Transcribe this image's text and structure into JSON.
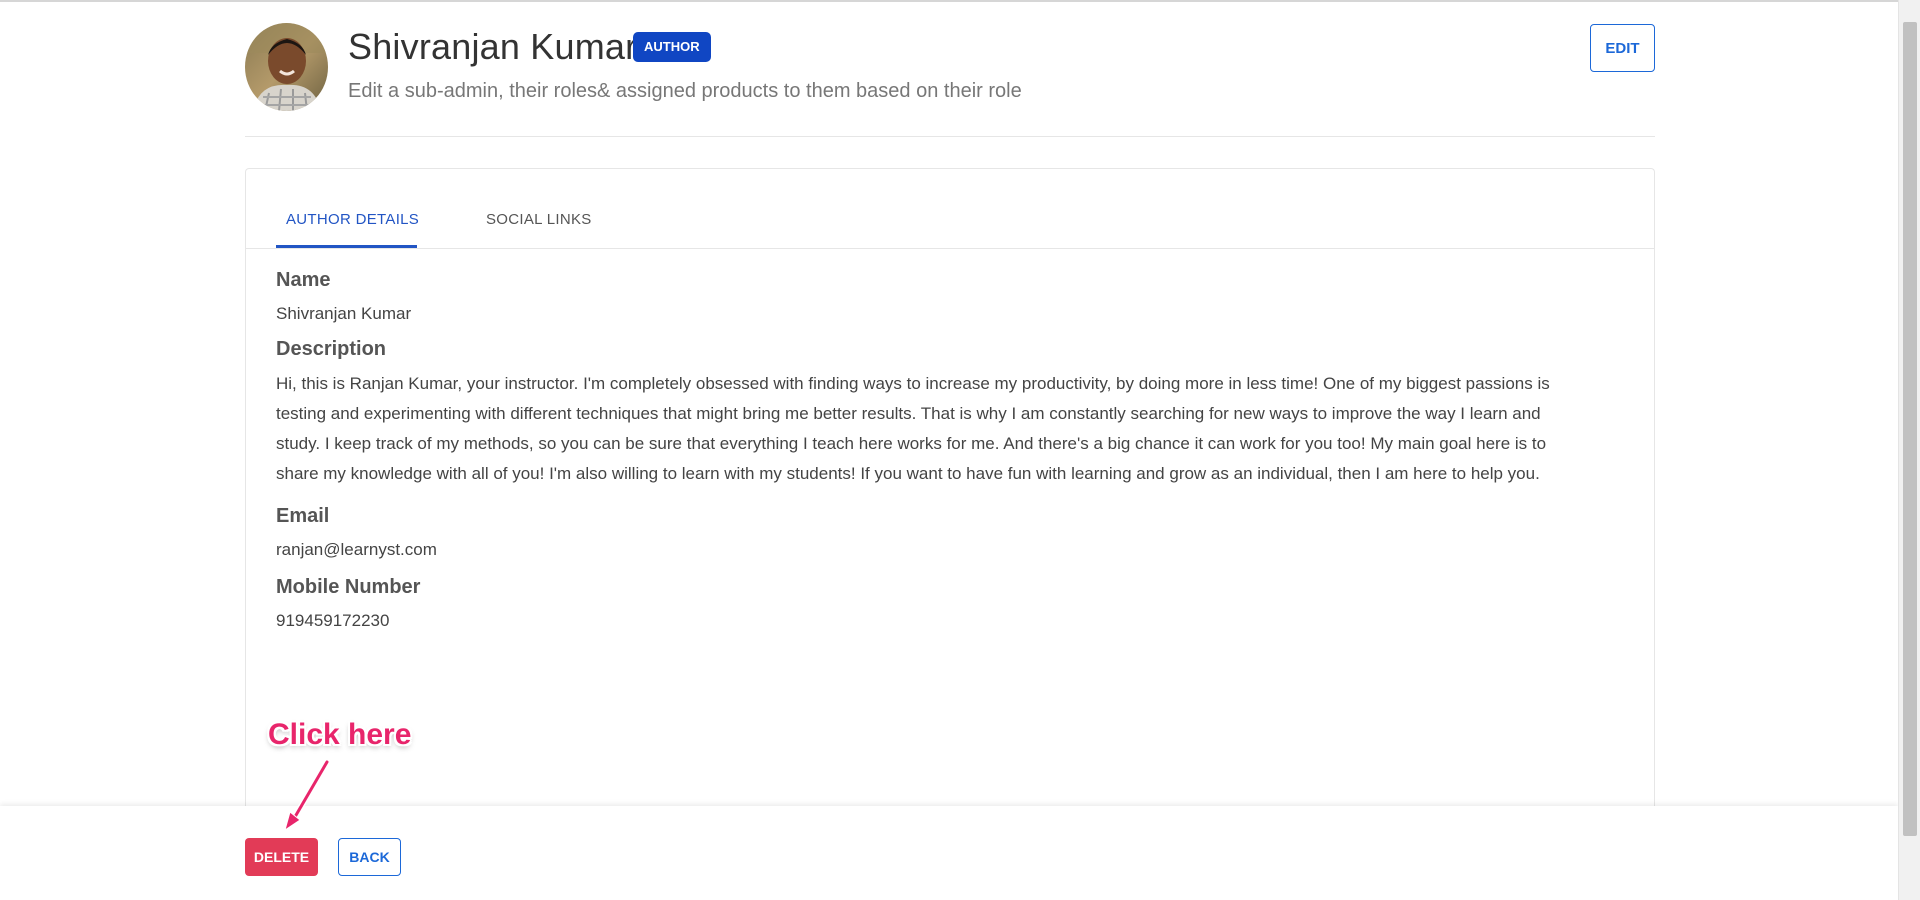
{
  "header": {
    "name": "Shivranjan Kumar",
    "badge": "AUTHOR",
    "subtitle": "Edit a sub-admin, their roles& assigned products to them based on their role",
    "edit_label": "EDIT"
  },
  "tabs": [
    {
      "label": "AUTHOR DETAILS",
      "active": true
    },
    {
      "label": "SOCIAL LINKS",
      "active": false
    }
  ],
  "details": {
    "name_label": "Name",
    "name_value": "Shivranjan Kumar",
    "description_label": "Description",
    "description_lines": [
      "Hi, this is Ranjan Kumar, your instructor.  I'm completely obsessed with finding ways to increase my productivity, by doing more in less time! One of my biggest passions is",
      "testing and experimenting with different techniques that might bring me better results. That is why I am constantly searching for new ways to improve the way I learn and",
      "study. I keep track of my methods, so you can be sure that everything I teach here works for me. And there's a big chance it can work for you too! My main goal here is to",
      "share my knowledge with all of you! I'm also willing to learn with my students! If you want to have fun with learning and grow as an individual, then I am here to help you."
    ],
    "email_label": "Email",
    "email_value": "ranjan@learnyst.com",
    "mobile_label": "Mobile Number",
    "mobile_value": "919459172230"
  },
  "annotation": {
    "text": "Click here"
  },
  "footer": {
    "delete_label": "DELETE",
    "back_label": "BACK"
  },
  "colors": {
    "primary": "#1c68d8",
    "badge": "#1046c3",
    "danger": "#e23b57",
    "annotation": "#e8256b"
  },
  "icons": {
    "avatar": "user-avatar-photo",
    "arrow": "annotation-arrow"
  }
}
